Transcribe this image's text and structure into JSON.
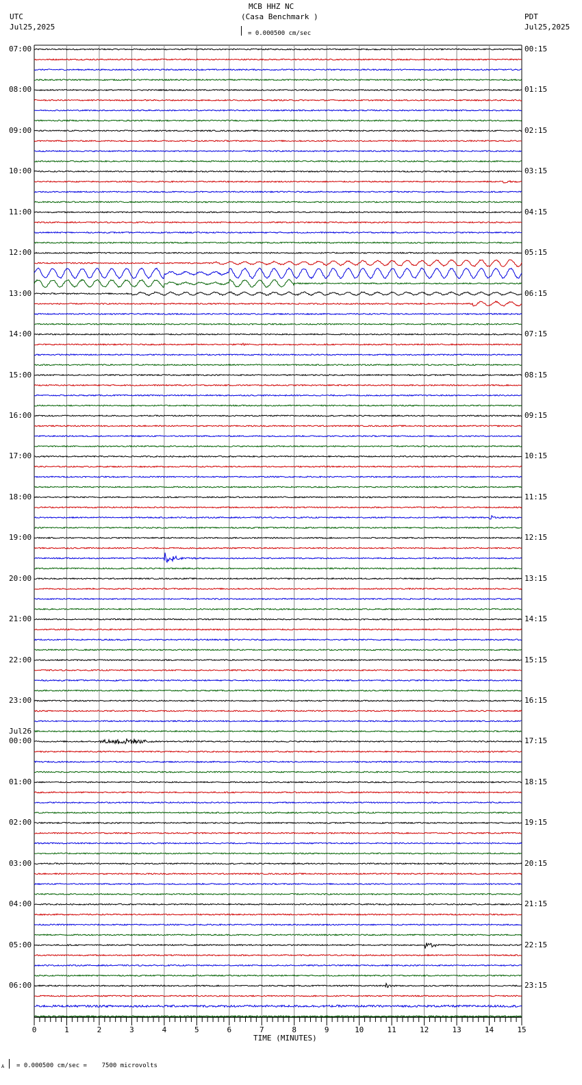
{
  "header": {
    "station": "MCB HHZ NC",
    "site": "(Casa Benchmark )",
    "scale_text": "= 0.000500 cm/sec",
    "left_tz": "UTC",
    "left_date": "Jul25,2025",
    "right_tz": "PDT",
    "right_date": "Jul25,2025"
  },
  "footer": {
    "scale_text": "= 0.000500 cm/sec =    7500 microvolts",
    "prefix": "A"
  },
  "chart_data": {
    "type": "line",
    "subtype": "helicorder",
    "xlabel": "TIME (MINUTES)",
    "xlim": [
      0,
      15
    ],
    "x_ticks": [
      "0",
      "1",
      "2",
      "3",
      "4",
      "5",
      "6",
      "7",
      "8",
      "9",
      "10",
      "11",
      "12",
      "13",
      "14",
      "15"
    ],
    "traces_per_hour": 4,
    "trace_colors": [
      "#000000",
      "#d00000",
      "#0000e0",
      "#006000"
    ],
    "left_labels": [
      "07:00",
      "08:00",
      "09:00",
      "10:00",
      "11:00",
      "12:00",
      "13:00",
      "14:00",
      "15:00",
      "16:00",
      "17:00",
      "18:00",
      "19:00",
      "20:00",
      "21:00",
      "22:00",
      "23:00",
      "00:00",
      "01:00",
      "02:00",
      "03:00",
      "04:00",
      "05:00",
      "06:00"
    ],
    "date_change_label": "Jul26",
    "date_change_index": 17,
    "right_labels": [
      "00:15",
      "01:15",
      "02:15",
      "03:15",
      "04:15",
      "05:15",
      "06:15",
      "07:15",
      "08:15",
      "09:15",
      "10:15",
      "11:15",
      "12:15",
      "13:15",
      "14:15",
      "15:15",
      "16:15",
      "17:15",
      "18:15",
      "19:15",
      "20:15",
      "21:15",
      "22:15",
      "23:15"
    ],
    "events": [
      {
        "trace": 13,
        "start_min": 14.4,
        "dur_min": 0.5,
        "amp": 4,
        "kind": "local"
      },
      {
        "trace": 21,
        "start_min": 5.5,
        "dur_min": 9.5,
        "amp": 5,
        "kind": "surface"
      },
      {
        "trace": 22,
        "start_min": 0,
        "dur_min": 15,
        "amp": 7,
        "kind": "surface"
      },
      {
        "trace": 23,
        "start_min": 0,
        "dur_min": 8,
        "amp": 5,
        "kind": "surface"
      },
      {
        "trace": 24,
        "start_min": 3,
        "dur_min": 12,
        "amp": 2,
        "kind": "surface"
      },
      {
        "trace": 25,
        "start_min": 13.5,
        "dur_min": 1.5,
        "amp": 3,
        "kind": "surface"
      },
      {
        "trace": 29,
        "start_min": 6.4,
        "dur_min": 0.3,
        "amp": 3,
        "kind": "local"
      },
      {
        "trace": 46,
        "start_min": 14.0,
        "dur_min": 0.6,
        "amp": 4,
        "kind": "local"
      },
      {
        "trace": 50,
        "start_min": 4.0,
        "dur_min": 1.0,
        "amp": 9,
        "kind": "local"
      },
      {
        "trace": 68,
        "start_min": 1.8,
        "dur_min": 2.0,
        "amp": 4,
        "kind": "emergent"
      },
      {
        "trace": 88,
        "start_min": 12.0,
        "dur_min": 1.0,
        "amp": 5,
        "kind": "local"
      },
      {
        "trace": 92,
        "start_min": 10.8,
        "dur_min": 0.5,
        "amp": 5,
        "kind": "local"
      }
    ]
  }
}
